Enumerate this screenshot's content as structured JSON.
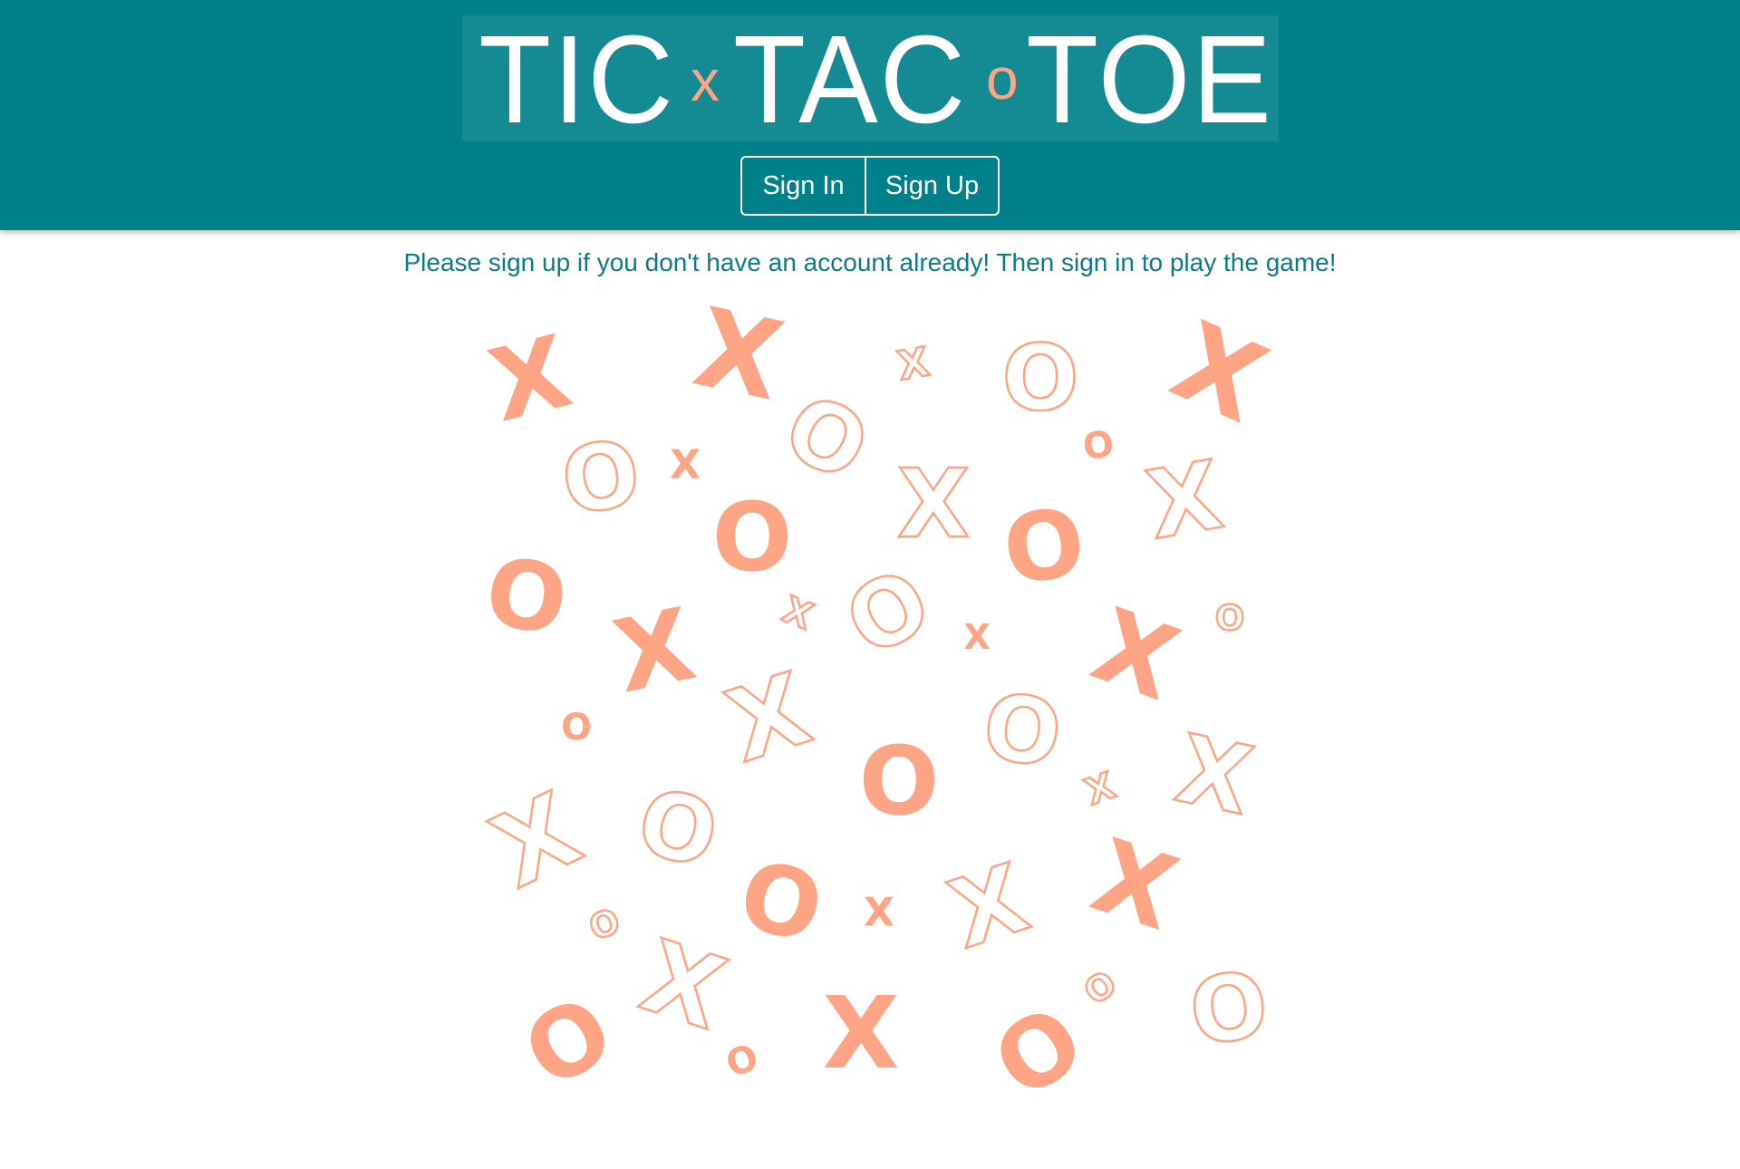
{
  "header": {
    "title": {
      "word1": "TIC",
      "sep1": "x",
      "word2": "TAC",
      "sep2": "o",
      "word3": "TOE"
    },
    "buttons": {
      "sign_in": "Sign In",
      "sign_up": "Sign Up"
    }
  },
  "main": {
    "message": "Please sign up if you don't have an account already! Then sign in to play the game!"
  },
  "decoration": {
    "name": "xo-pattern"
  },
  "colors": {
    "brand": "#00818a",
    "accent": "#ffa585",
    "message_text": "#0f7a87"
  }
}
